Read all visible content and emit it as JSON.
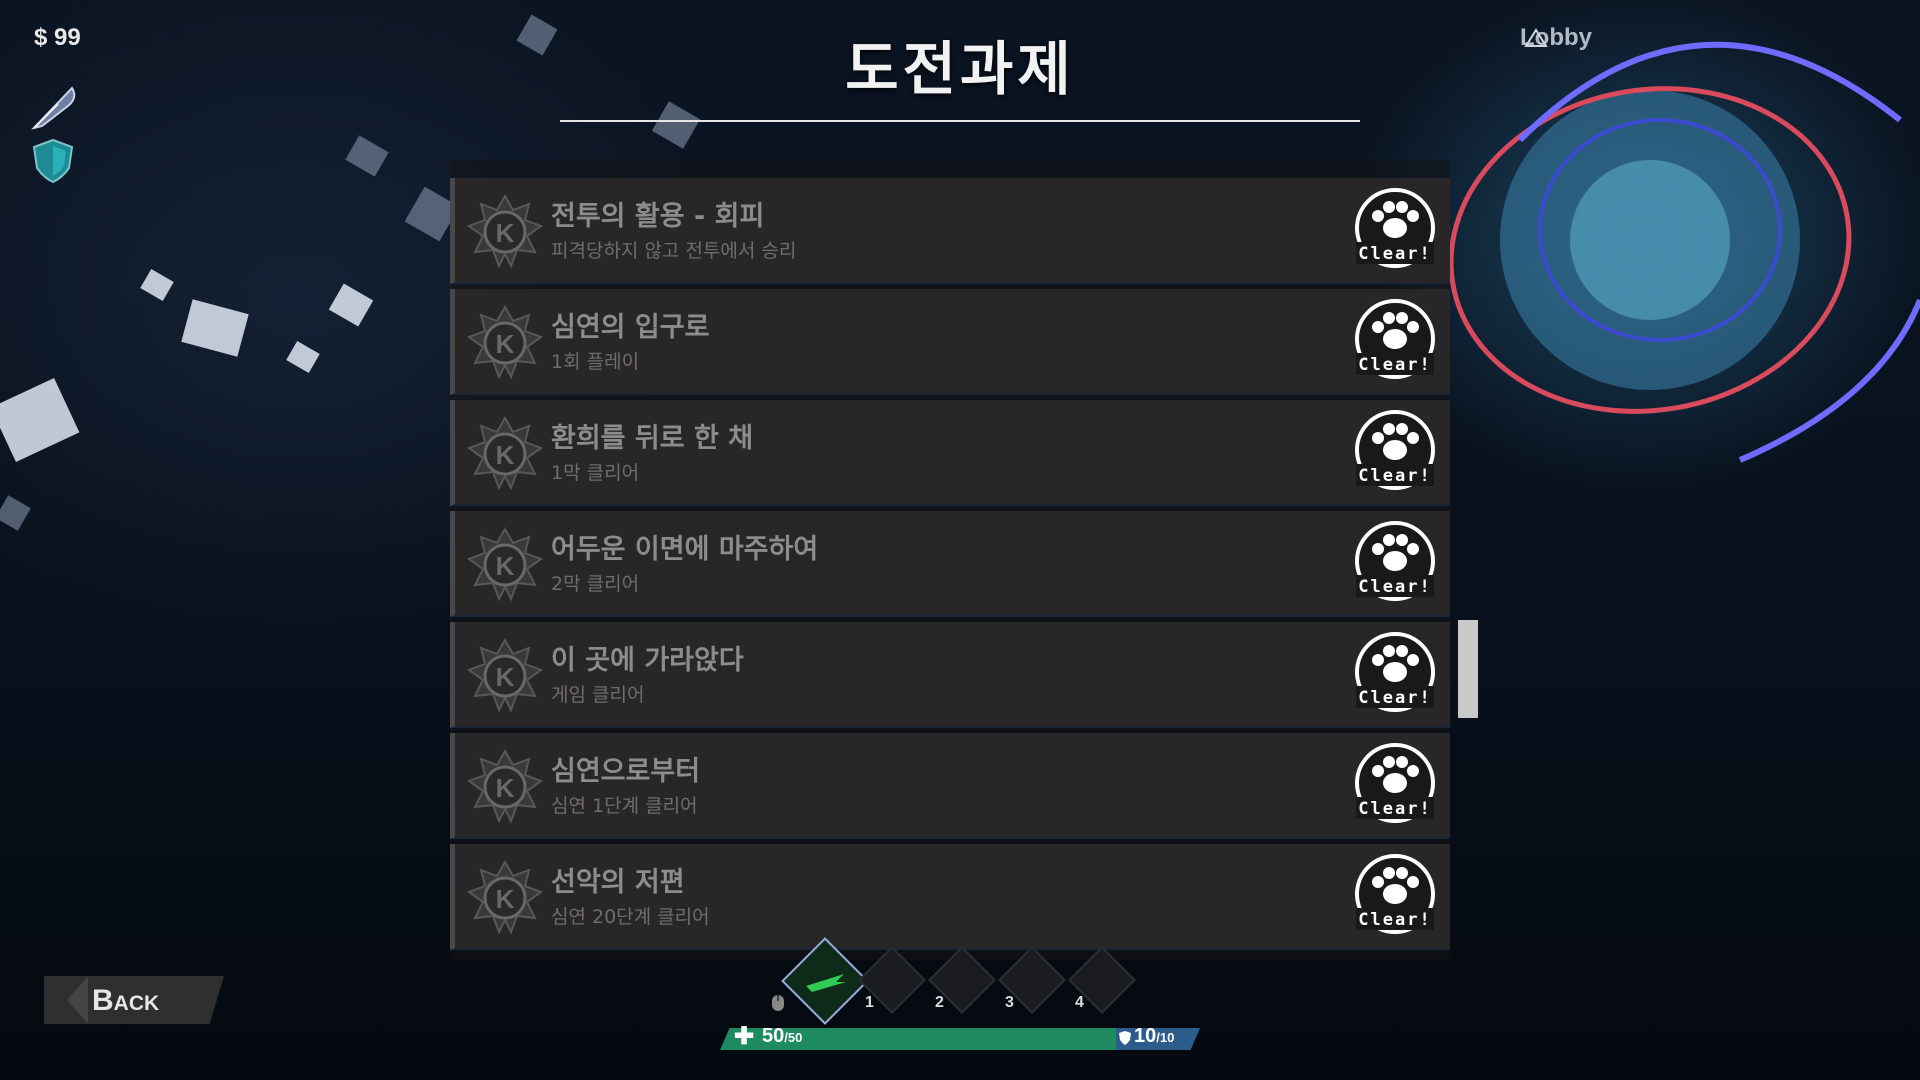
{
  "hud": {
    "money": "$ 99",
    "lobby_label": "Lobby"
  },
  "title": "도전과제",
  "achievements": [
    {
      "name": "전투의 활용 - 회피",
      "desc": "피격당하지 않고 전투에서 승리",
      "status": "Clear!"
    },
    {
      "name": "심연의 입구로",
      "desc": "1회 플레이",
      "status": "Clear!"
    },
    {
      "name": "환희를 뒤로 한 채",
      "desc": "1막 클리어",
      "status": "Clear!"
    },
    {
      "name": "어두운 이면에 마주하여",
      "desc": "2막 클리어",
      "status": "Clear!"
    },
    {
      "name": "이 곳에 가라앉다",
      "desc": "게임 클리어",
      "status": "Clear!"
    },
    {
      "name": "심연으로부터",
      "desc": "심연 1단계 클리어",
      "status": "Clear!"
    },
    {
      "name": "선악의 저편",
      "desc": "심연 20단계 클리어",
      "status": "Clear!"
    }
  ],
  "back_label": "Back",
  "skill_slots": [
    "1",
    "2",
    "3",
    "4"
  ],
  "health": {
    "current": "50",
    "max": "/50"
  },
  "shield": {
    "current": "10",
    "max": "/10"
  },
  "colors": {
    "health": "#1d8a5f",
    "shield": "#2b5c8c",
    "row_bg": "#282626"
  }
}
